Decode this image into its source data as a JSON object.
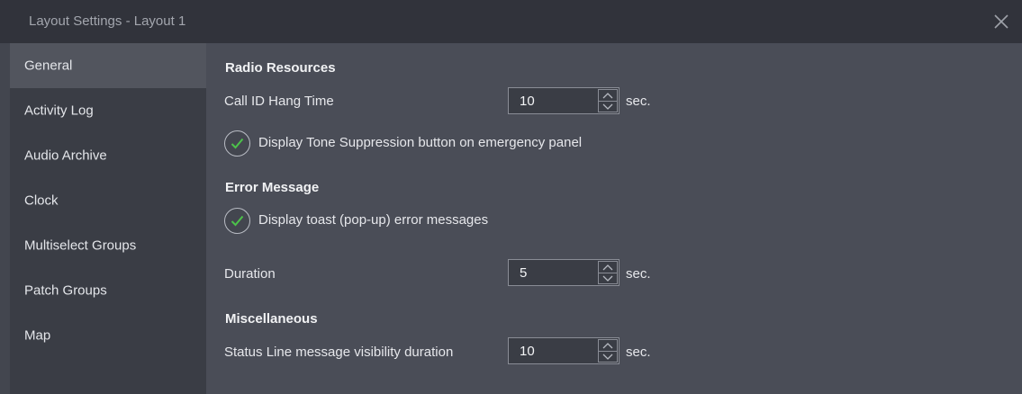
{
  "window": {
    "title": "Layout Settings - Layout 1"
  },
  "sidebar": {
    "items": [
      {
        "label": "General",
        "active": true
      },
      {
        "label": "Activity Log",
        "active": false
      },
      {
        "label": "Audio Archive",
        "active": false
      },
      {
        "label": "Clock",
        "active": false
      },
      {
        "label": "Multiselect Groups",
        "active": false
      },
      {
        "label": "Patch Groups",
        "active": false
      },
      {
        "label": "Map",
        "active": false
      }
    ]
  },
  "content": {
    "radio_resources": {
      "heading": "Radio Resources",
      "call_id_label": "Call ID Hang Time",
      "call_id_value": "10",
      "call_id_unit": "sec.",
      "tone_suppression_label": "Display Tone Suppression button on emergency panel",
      "tone_suppression_checked": true
    },
    "error_message": {
      "heading": "Error Message",
      "toast_label": "Display toast (pop-up) error messages",
      "toast_checked": true,
      "duration_label": "Duration",
      "duration_value": "5",
      "duration_unit": "sec."
    },
    "miscellaneous": {
      "heading": "Miscellaneous",
      "status_line_label": "Status Line message visibility duration",
      "status_line_value": "10",
      "status_line_unit": "sec."
    }
  },
  "colors": {
    "checkmark": "#4cc24a",
    "titlebar": "#31333b",
    "sidebar_active": "#52555e",
    "content_bg": "#4a4d57"
  }
}
